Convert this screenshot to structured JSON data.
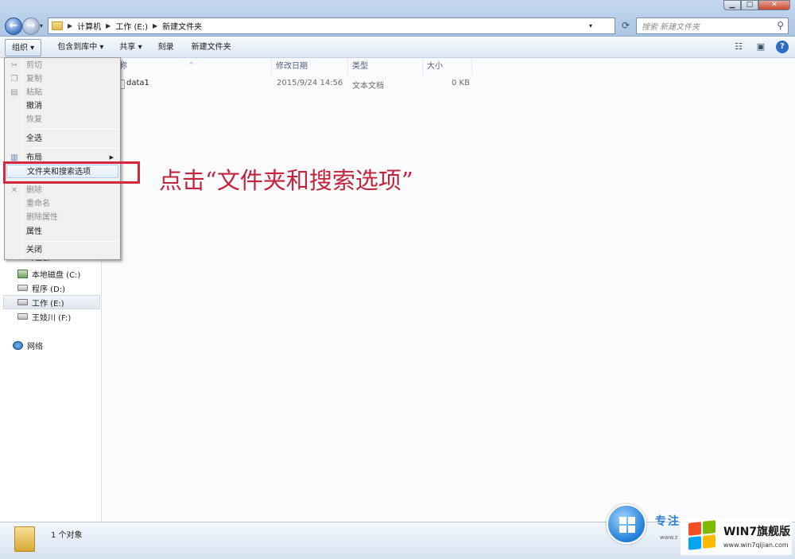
{
  "address_bar": {
    "crumbs": [
      "计算机",
      "工作 (E:)",
      "新建文件夹"
    ]
  },
  "search": {
    "placeholder": "搜索 新建文件夹"
  },
  "toolbar": {
    "organize": "组织 ▾",
    "include_in_library": "包含到库中 ▾",
    "share": "共享 ▾",
    "burn": "刻录",
    "new_folder": "新建文件夹"
  },
  "columns": {
    "name": "称",
    "date_modified": "修改日期",
    "type": "类型",
    "size": "大小"
  },
  "files": [
    {
      "name": "data1",
      "date_modified": "2015/9/24 14:56",
      "type": "文本文档",
      "size": "0 KB"
    }
  ],
  "context_menu": {
    "items": [
      {
        "label": "剪切",
        "disabled": true
      },
      {
        "label": "复制",
        "disabled": true
      },
      {
        "label": "粘贴",
        "disabled": true
      },
      {
        "label": "撤消",
        "disabled": false
      },
      {
        "label": "恢复",
        "disabled": true
      },
      {
        "label": "全选",
        "disabled": false
      },
      {
        "label": "布局",
        "disabled": false
      },
      {
        "label": "文件夹和搜索选项",
        "disabled": false
      },
      {
        "label": "删除",
        "disabled": true
      },
      {
        "label": "重命名",
        "disabled": true
      },
      {
        "label": "删除属性",
        "disabled": true
      },
      {
        "label": "属性",
        "disabled": false
      },
      {
        "label": "关闭",
        "disabled": false
      }
    ]
  },
  "nav_pane": {
    "computer_label": "计算机",
    "drives": [
      "本地磁盘 (C:)",
      "程序 (D:)",
      "工作 (E:)",
      "王妓川 (F:)"
    ],
    "network": "网络"
  },
  "annotation": {
    "text": "点击“文件夹和搜索选项”",
    "color": "#c2243c"
  },
  "status_bar": {
    "text": "1 个对象"
  },
  "watermark": {
    "site_cn": "专注",
    "small_url": "www.z",
    "title": "WIN7旗舰版",
    "url": "www.win7qijian.com"
  },
  "colors": {
    "highlight_box": "#d4263d",
    "accent_blue": "#2e6bc3"
  }
}
